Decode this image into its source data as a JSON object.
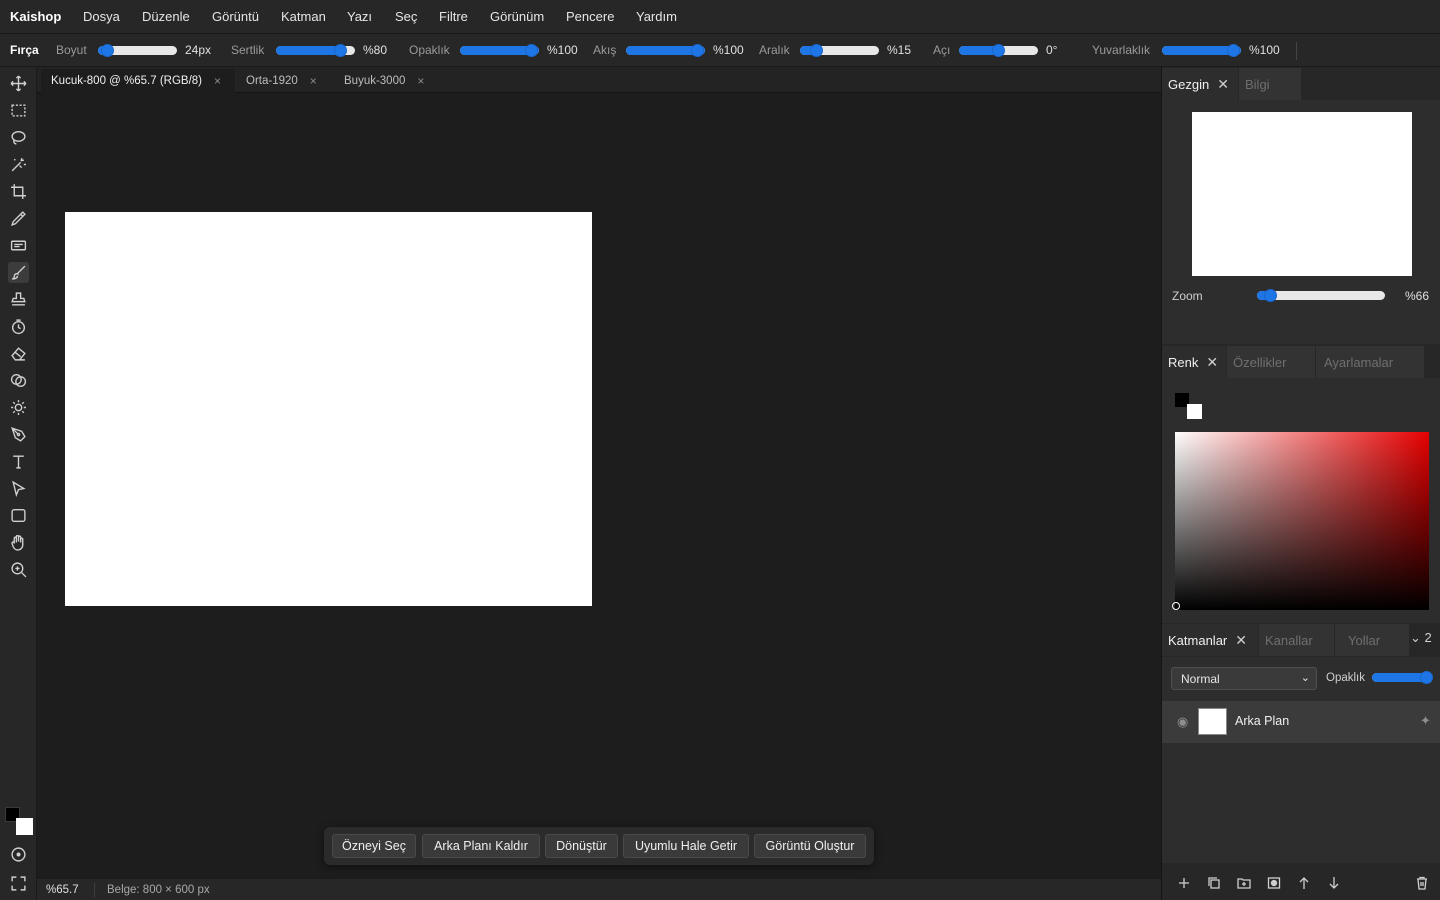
{
  "menu": {
    "app": "Kaishop",
    "items": [
      "Dosya",
      "Düzenle",
      "Görüntü",
      "Katman",
      "Yazı",
      "Seç",
      "Filtre",
      "Görünüm",
      "Pencere",
      "Yardım"
    ]
  },
  "options": {
    "tool_name": "Fırça",
    "size_label": "Boyut",
    "size_value": "24px",
    "hardness_label": "Sertlik",
    "hardness_value": "%80",
    "opacity_label": "Opaklık",
    "opacity_value": "%100",
    "flow_label": "Akış",
    "flow_value": "%100",
    "spacing_label": "Aralık",
    "spacing_value": "%15",
    "angle_label": "Açı",
    "angle_value": "0°",
    "roundness_label": "Yuvarlaklık",
    "roundness_value": "%100"
  },
  "tools": [
    "move-tool",
    "marquee-tool",
    "lasso-tool",
    "magic-wand-tool",
    "crop-tool",
    "eyedropper-tool",
    "frame-tool",
    "brush-tool",
    "stamp-tool",
    "history-tool",
    "eraser-tool",
    "shape-layers-tool",
    "light-tool",
    "pen-tool",
    "type-tool",
    "path-select-tool",
    "rectangle-tool",
    "hand-tool",
    "zoom-tool"
  ],
  "tabs": [
    {
      "label": "Kucuk-800 @ %65.7 (RGB/8)",
      "close": "×"
    },
    {
      "label": "Orta-1920",
      "close": "×"
    },
    {
      "label": "Buyuk-3000",
      "close": "×"
    }
  ],
  "context_bar": {
    "select_subject": "Özneyi Seç",
    "remove_bg": "Arka Planı Kaldır",
    "transform": "Dönüştür",
    "harmonize": "Uyumlu Hale Getir",
    "generate": "Görüntü Oluştur"
  },
  "status": {
    "zoom": "%65.7",
    "doc": "Belge: 800 × 600 px"
  },
  "navigator": {
    "tab_active": "Gezgin",
    "tab_info": "Bilgi",
    "zoom_label": "Zoom",
    "zoom_value": "%66"
  },
  "color_panel": {
    "tab_color": "Renk",
    "tab_props": "Özellikler",
    "tab_adjust": "Ayarlamalar"
  },
  "layers_panel": {
    "tab_layers": "Katmanlar",
    "tab_channels": "Kanallar",
    "tab_paths": "Yollar",
    "collapse_count": "2",
    "blend_mode": "Normal",
    "opacity_label": "Opaklık",
    "layer_name": "Arka Plan"
  },
  "colors": {
    "accent": "#1e76e6",
    "foreground": "#000000",
    "background": "#ffffff"
  }
}
